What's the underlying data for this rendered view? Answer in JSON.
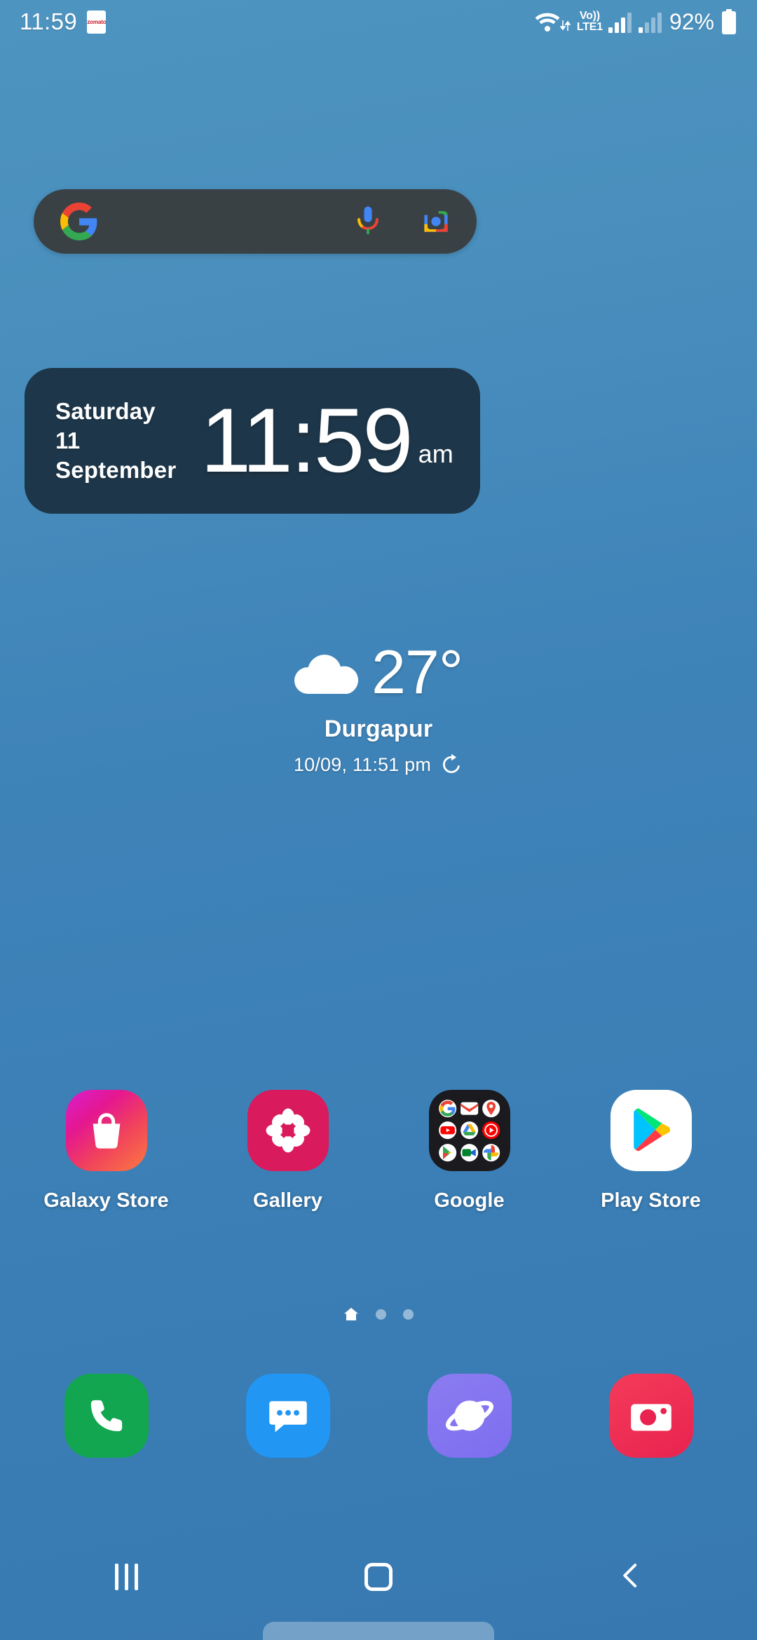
{
  "status_bar": {
    "clock": "11:59",
    "notification_icons": [
      {
        "name": "zomato-notification-icon",
        "label": "zomato"
      }
    ],
    "wifi_icon": "wifi-icon",
    "data_arrows_icon": "data-transfer-icon",
    "volte_top": "Vo))",
    "volte_bottom": "LTE1",
    "signal_sim1_icon": "signal-bars-icon",
    "signal_sim2_icon": "signal-bars-icon",
    "battery_percent": "92%",
    "battery_icon": "battery-full-icon"
  },
  "search": {
    "google_logo_icon": "google-g-icon",
    "mic_icon": "microphone-icon",
    "lens_icon": "google-lens-camera-icon",
    "placeholder": "",
    "value": ""
  },
  "clock_widget": {
    "weekday": "Saturday",
    "date": "11 September",
    "time": "11:59",
    "meridiem": "am",
    "background_color": "#1d3649"
  },
  "weather": {
    "condition_icon": "cloud-icon",
    "temperature": "27°",
    "city": "Durgapur",
    "updated": "10/09, 11:51 pm",
    "refresh_icon": "refresh-icon"
  },
  "apps": [
    {
      "label": "Galaxy Store",
      "icon": "galaxy-store-icon"
    },
    {
      "label": "Gallery",
      "icon": "gallery-icon"
    },
    {
      "label": "Google",
      "icon": "google-folder-icon"
    },
    {
      "label": "Play Store",
      "icon": "play-store-icon"
    }
  ],
  "google_folder_apps": [
    "google-search-icon",
    "gmail-icon",
    "maps-icon",
    "youtube-icon",
    "drive-icon",
    "youtube-music-icon",
    "play-store-icon",
    "meet-icon",
    "photos-icon"
  ],
  "page_indicator": {
    "pages": 3,
    "current": 1,
    "home_icon": "home-page-icon"
  },
  "dock": [
    {
      "label": "Phone",
      "icon": "phone-icon"
    },
    {
      "label": "Messages",
      "icon": "messages-icon"
    },
    {
      "label": "Samsung Internet",
      "icon": "internet-browser-icon"
    },
    {
      "label": "Camera",
      "icon": "camera-icon"
    }
  ],
  "navigation_bar": {
    "recents_icon": "recents-icon",
    "home_icon": "home-icon",
    "back_icon": "back-icon"
  },
  "colors": {
    "wallpaper_top": "#4d94c0",
    "wallpaper_bottom": "#3778b0",
    "search_bar": "#3a4145",
    "clock_widget": "#1d3649"
  }
}
